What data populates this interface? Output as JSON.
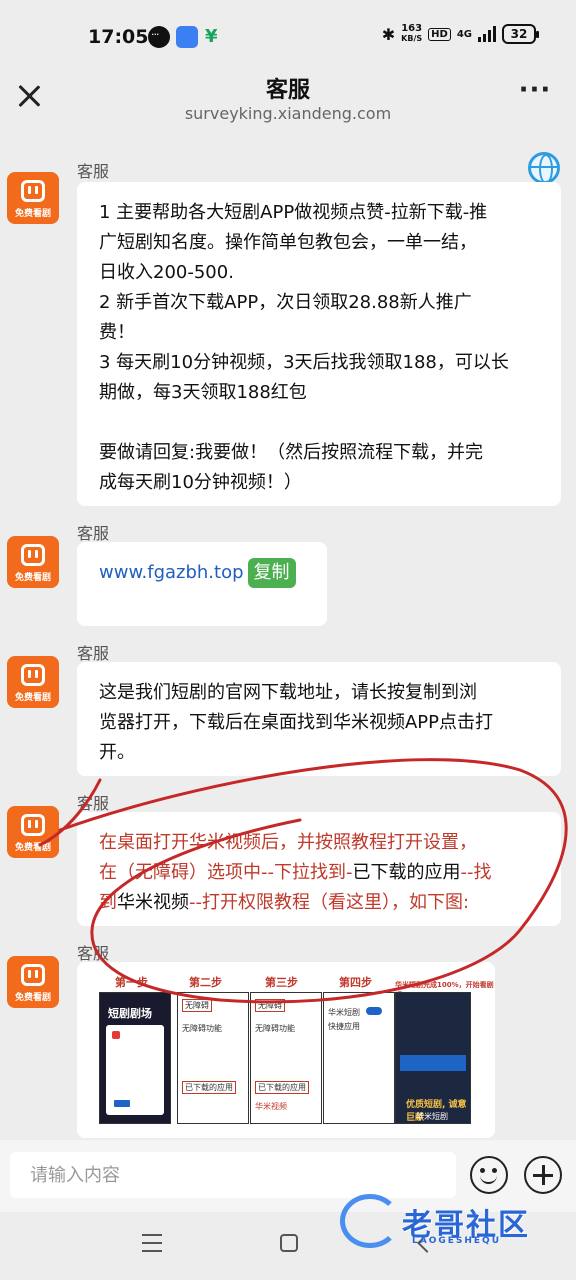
{
  "status_bar": {
    "time": "17:05",
    "net_speed": "163",
    "net_unit": "KB/S",
    "hd": "HD",
    "network": "4G",
    "battery": "32",
    "icons": [
      "chat-bubble-icon",
      "app-store-icon",
      "money-app-icon",
      "bluetooth-icon",
      "signal-icon",
      "battery-icon"
    ]
  },
  "header": {
    "title": "客服",
    "url": "surveyking.xiandeng.com",
    "close_icon": "close-icon",
    "more_label": "···"
  },
  "avatar": {
    "text": "免费看剧",
    "color": "#f26a1b"
  },
  "messages": [
    {
      "sender": "客服",
      "lines": [
        "1 主要帮助各大短剧APP做视频点赞-拉新下载-推",
        "广短剧知名度。操作简单包教包会，一单一结，",
        "日收入200-500.",
        "2 新手首次下载APP，次日领取28.88新人推广",
        "费！",
        "3 每天刷10分钟视频，3天后找我领取188，可以长",
        "期做，每3天领取188红包",
        "",
        "要做请回复:我要做！（然后按照流程下载，并完",
        "成每天刷10分钟视频！）"
      ]
    },
    {
      "sender": "客服",
      "link": "www.fgazbh.top",
      "copy_label": "复制"
    },
    {
      "sender": "客服",
      "lines": [
        "这是我们短剧的官网下载地址，请长按复制到浏",
        "览器打开，下载后在桌面找到华米视频APP点击打",
        "开。"
      ]
    },
    {
      "sender": "客服",
      "line1": "在桌面打开华米视频后，并按照教程打开设置，",
      "line2_a": "在（无障碍）选项中--下拉找到-",
      "line2_b": "已下载的应用",
      "line2_c": "--找",
      "line3_a": "到",
      "line3_b": "华米视频",
      "line3_c": "--打开权限教程（看这里），如下图:"
    },
    {
      "sender": "客服",
      "tutorial": {
        "steps": [
          "第一步",
          "第二步",
          "第三步",
          "第四步"
        ],
        "step2_box": "无障碍",
        "step2_item": "无障碍功能",
        "step2_highlight": "已下载的应用",
        "step3_box": "无障碍",
        "step3_item": "无障碍功能",
        "step3_highlight": "已下载的应用",
        "step3_app": "华米视频",
        "step4_app": "华米短剧",
        "step4_item": "快捷应用",
        "step1_title": "短剧剧场",
        "step5_slogan": "优质短剧, 诚意巨献",
        "step5_brand": "华米短剧",
        "step5_top": "华米短剧完成100%，开始看剧吧"
      }
    }
  ],
  "input": {
    "placeholder": "请输入内容"
  },
  "watermark": {
    "text": "老哥社区",
    "sub": "LAOGESHEQU"
  }
}
